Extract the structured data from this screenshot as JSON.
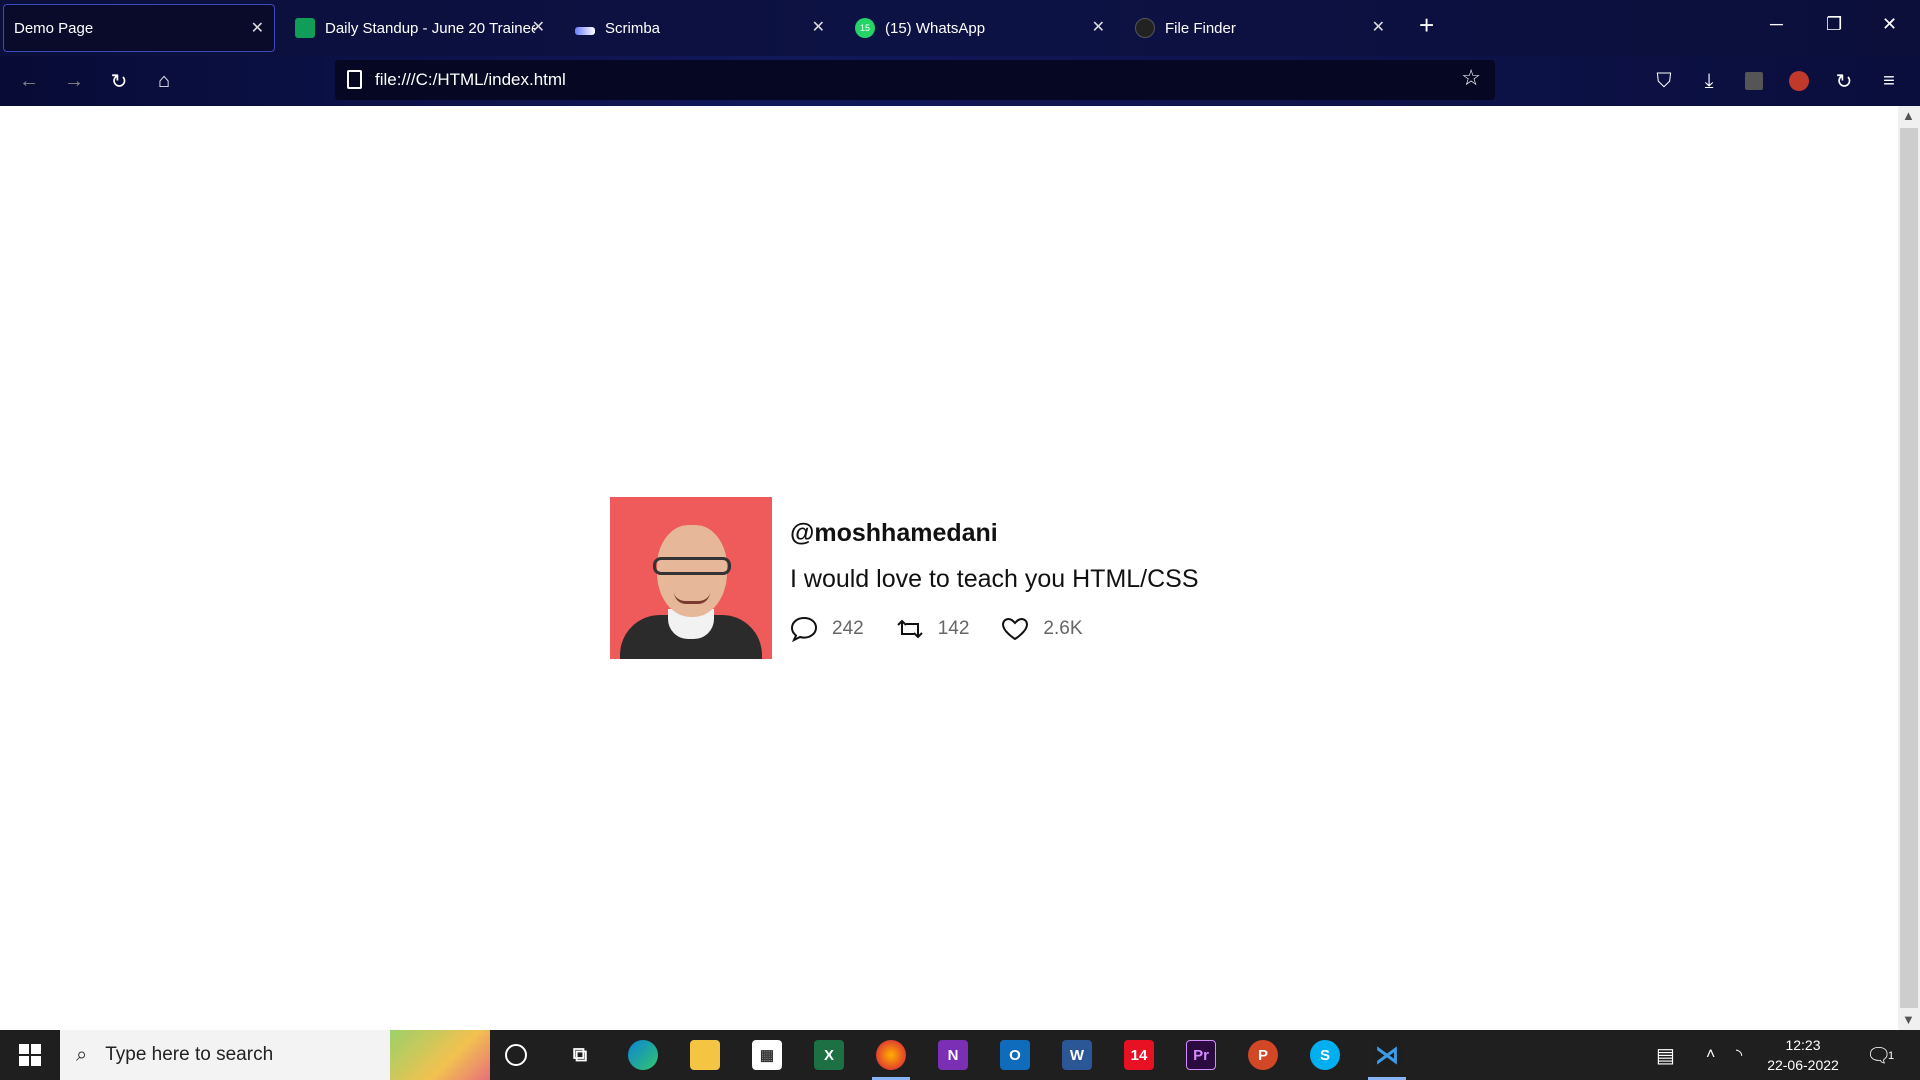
{
  "tabs": [
    {
      "label": "Demo Page",
      "active": true,
      "icon": "page-icon"
    },
    {
      "label": "Daily Standup - June 20 Trainee",
      "icon": "sheets-icon"
    },
    {
      "label": "Scrimba",
      "icon": "scrimba-icon"
    },
    {
      "label": "(15) WhatsApp",
      "icon": "whatsapp-icon",
      "badge": "15"
    },
    {
      "label": "File Finder",
      "icon": "github-icon"
    }
  ],
  "navbar": {
    "url": "file:///C:/HTML/index.html"
  },
  "tweet": {
    "handle": "@moshhamedani",
    "message": "I would love to teach you HTML/CSS",
    "comments": "242",
    "retweets": "142",
    "likes": "2.6K"
  },
  "taskbar": {
    "search_placeholder": "Type here to search",
    "time": "12:23",
    "date": "22-06-2022",
    "notification_count": "1"
  },
  "colors": {
    "tab_bg": "#0b0f3a",
    "accent": "#3b4abf",
    "avatar_bg": "#ef5a5a"
  }
}
